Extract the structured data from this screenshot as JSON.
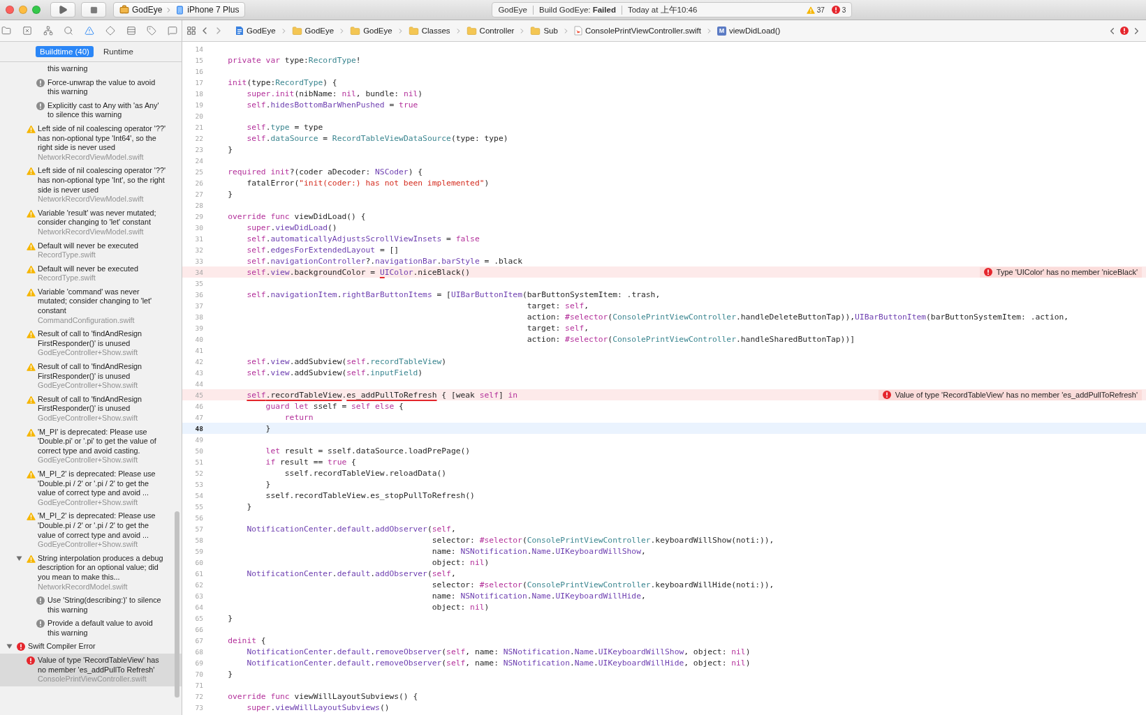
{
  "toolbar": {
    "scheme": "GodEye",
    "destination": "iPhone 7 Plus",
    "activity": {
      "project": "GodEye",
      "status": "Build GodEye: **Failed**",
      "time": "Today at 上午10:46",
      "warnings": "37",
      "errors": "3"
    }
  },
  "navigator_tabs": [
    {
      "selected": false
    },
    {
      "selected": false
    },
    {
      "selected": false
    },
    {
      "selected": false
    },
    {
      "selected": true
    },
    {
      "selected": false
    },
    {
      "selected": false
    },
    {
      "selected": false
    },
    {
      "selected": false
    }
  ],
  "jump_bar": {
    "crumbs": [
      {
        "kind": "project",
        "label": "GodEye"
      },
      {
        "kind": "folder",
        "label": "GodEye"
      },
      {
        "kind": "folder",
        "label": "GodEye"
      },
      {
        "kind": "folder",
        "label": "Classes"
      },
      {
        "kind": "folder",
        "label": "Controller"
      },
      {
        "kind": "folder",
        "label": "Sub"
      },
      {
        "kind": "file",
        "label": "ConsolePrintViewController.swift"
      },
      {
        "kind": "method",
        "badge": "M",
        "label": "viewDidLoad()"
      }
    ]
  },
  "issue_navigator": {
    "filters": [
      {
        "label": "Buildtime (40)",
        "selected": true
      },
      {
        "label": "Runtime",
        "selected": false
      }
    ],
    "items": [
      {
        "kind": "note",
        "clipped": true,
        "text": "this warning",
        "selected": false
      },
      {
        "kind": "note",
        "text": "Force-unwrap the value to avoid this warning",
        "selected": false
      },
      {
        "kind": "note",
        "text": "Explicitly cast to Any with 'as Any' to silence this warning",
        "selected": false
      },
      {
        "kind": "warning",
        "text": "Left side of nil coalescing operator '??' has non-optional type 'Int64', so the right side is never used",
        "file": "NetworkRecordViewModel.swift",
        "selected": false
      },
      {
        "kind": "warning",
        "text": "Left side of nil coalescing operator '??' has non-optional type 'Int', so the right side is never used",
        "file": "NetworkRecordViewModel.swift",
        "selected": false
      },
      {
        "kind": "warning",
        "text": "Variable 'result' was never mutated; consider changing to 'let' constant",
        "file": "NetworkRecordViewModel.swift",
        "selected": false
      },
      {
        "kind": "warning",
        "text": "Default will never be executed",
        "file": "RecordType.swift",
        "selected": false
      },
      {
        "kind": "warning",
        "text": "Default will never be executed",
        "file": "RecordType.swift",
        "selected": false
      },
      {
        "kind": "warning",
        "text": "Variable 'command' was never mutated; consider changing to 'let' constant",
        "file": "CommandConfiguration.swift",
        "selected": false
      },
      {
        "kind": "warning",
        "text": "Result of call to 'findAndResign FirstResponder()' is unused",
        "file": "GodEyeController+Show.swift",
        "selected": false
      },
      {
        "kind": "warning",
        "text": "Result of call to 'findAndResign FirstResponder()' is unused",
        "file": "GodEyeController+Show.swift",
        "selected": false
      },
      {
        "kind": "warning",
        "text": "Result of call to 'findAndResign FirstResponder()' is unused",
        "file": "GodEyeController+Show.swift",
        "selected": false
      },
      {
        "kind": "warning",
        "text": "'M_PI' is deprecated: Please use 'Double.pi' or '.pi' to get the value of correct type and avoid casting.",
        "file": "GodEyeController+Show.swift",
        "selected": false
      },
      {
        "kind": "warning",
        "text": "'M_PI_2' is deprecated: Please use 'Double.pi / 2' or '.pi / 2' to get the value of correct type and avoid ...",
        "file": "GodEyeController+Show.swift",
        "selected": false
      },
      {
        "kind": "warning",
        "text": "'M_PI_2' is deprecated: Please use 'Double.pi / 2' or '.pi / 2' to get the value of correct type and avoid ...",
        "file": "GodEyeController+Show.swift",
        "selected": false
      },
      {
        "kind": "warning",
        "text": "String interpolation produces a debug description for an optional value; did you mean to make this...",
        "file": "NetworkRecordModel.swift",
        "selected": false,
        "expanded": true,
        "children": [
          {
            "kind": "note",
            "text": "Use 'String(describing:)' to silence this warning",
            "selected": false
          },
          {
            "kind": "note",
            "text": "Provide a default value to avoid this warning",
            "selected": false
          }
        ]
      },
      {
        "kind": "category",
        "text": "Swift Compiler Error",
        "selected": false,
        "expanded": true,
        "children": [
          {
            "kind": "error",
            "text": "Value of type 'RecordTableView' has no member 'es_addPullTo Refresh'",
            "file": "ConsolePrintViewController.swift",
            "selected": true
          }
        ]
      }
    ]
  },
  "editor": {
    "lines": [
      {
        "number": "14",
        "current": false
      },
      {
        "number": "15",
        "current": false,
        "segments": [
          {
            "kind": "keyword",
            "text": "    private var "
          },
          {
            "kind": "plain",
            "text": "type:"
          },
          {
            "kind": "project",
            "text": "RecordType"
          },
          {
            "kind": "plain",
            "text": "!"
          }
        ]
      },
      {
        "number": "16",
        "current": false
      },
      {
        "number": "17",
        "current": false,
        "segments": [
          {
            "kind": "keyword",
            "text": "    init"
          },
          {
            "kind": "plain",
            "text": "(type:"
          },
          {
            "kind": "project",
            "text": "RecordType"
          },
          {
            "kind": "plain",
            "text": ") {"
          }
        ]
      },
      {
        "number": "18",
        "current": false,
        "segments": [
          {
            "kind": "keyword",
            "text": "        super.init"
          },
          {
            "kind": "plain",
            "text": "(nibName: "
          },
          {
            "kind": "keyword",
            "text": "nil"
          },
          {
            "kind": "plain",
            "text": ", bundle: "
          },
          {
            "kind": "keyword",
            "text": "nil"
          },
          {
            "kind": "plain",
            "text": ")"
          }
        ]
      },
      {
        "number": "19",
        "current": false,
        "segments": [
          {
            "kind": "keyword",
            "text": "        self"
          },
          {
            "kind": "plain",
            "text": "."
          },
          {
            "kind": "system",
            "text": "hidesBottomBarWhenPushed"
          },
          {
            "kind": "plain",
            "text": " = "
          },
          {
            "kind": "keyword",
            "text": "true"
          }
        ]
      },
      {
        "number": "20",
        "current": false
      },
      {
        "number": "21",
        "current": false,
        "segments": [
          {
            "kind": "keyword",
            "text": "        self"
          },
          {
            "kind": "plain",
            "text": "."
          },
          {
            "kind": "project",
            "text": "type"
          },
          {
            "kind": "plain",
            "text": " = type"
          }
        ]
      },
      {
        "number": "22",
        "current": false,
        "segments": [
          {
            "kind": "keyword",
            "text": "        self"
          },
          {
            "kind": "plain",
            "text": "."
          },
          {
            "kind": "project",
            "text": "dataSource"
          },
          {
            "kind": "plain",
            "text": " = "
          },
          {
            "kind": "project",
            "text": "RecordTableViewDataSource"
          },
          {
            "kind": "plain",
            "text": "(type: type)"
          }
        ]
      },
      {
        "number": "23",
        "current": false,
        "segments": [
          {
            "kind": "plain",
            "text": "    }"
          }
        ]
      },
      {
        "number": "24",
        "current": false
      },
      {
        "number": "25",
        "current": false,
        "segments": [
          {
            "kind": "keyword",
            "text": "    required init"
          },
          {
            "kind": "plain",
            "text": "?(coder aDecoder: "
          },
          {
            "kind": "system",
            "text": "NSCoder"
          },
          {
            "kind": "plain",
            "text": ") {"
          }
        ]
      },
      {
        "number": "26",
        "current": false,
        "segments": [
          {
            "kind": "plain",
            "text": "        fatalError("
          },
          {
            "kind": "string",
            "text": "\"init(coder:) has not been implemented\""
          },
          {
            "kind": "plain",
            "text": ")"
          }
        ]
      },
      {
        "number": "27",
        "current": false,
        "segments": [
          {
            "kind": "plain",
            "text": "    }"
          }
        ]
      },
      {
        "number": "28",
        "current": false
      },
      {
        "number": "29",
        "current": false,
        "segments": [
          {
            "kind": "keyword",
            "text": "    override func"
          },
          {
            "kind": "plain",
            "text": " viewDidLoad() {"
          }
        ]
      },
      {
        "number": "30",
        "current": false,
        "segments": [
          {
            "kind": "keyword",
            "text": "        super"
          },
          {
            "kind": "plain",
            "text": "."
          },
          {
            "kind": "system",
            "text": "viewDidLoad"
          },
          {
            "kind": "plain",
            "text": "()"
          }
        ]
      },
      {
        "number": "31",
        "current": false,
        "segments": [
          {
            "kind": "keyword",
            "text": "        self"
          },
          {
            "kind": "plain",
            "text": "."
          },
          {
            "kind": "system",
            "text": "automaticallyAdjustsScrollViewInsets"
          },
          {
            "kind": "plain",
            "text": " = "
          },
          {
            "kind": "keyword",
            "text": "false"
          }
        ]
      },
      {
        "number": "32",
        "current": false,
        "segments": [
          {
            "kind": "keyword",
            "text": "        self"
          },
          {
            "kind": "plain",
            "text": "."
          },
          {
            "kind": "system",
            "text": "edgesForExtendedLayout"
          },
          {
            "kind": "plain",
            "text": " = []"
          }
        ]
      },
      {
        "number": "33",
        "current": false,
        "segments": [
          {
            "kind": "keyword",
            "text": "        self"
          },
          {
            "kind": "plain",
            "text": "."
          },
          {
            "kind": "system",
            "text": "navigationController"
          },
          {
            "kind": "plain",
            "text": "?."
          },
          {
            "kind": "system",
            "text": "navigationBar"
          },
          {
            "kind": "plain",
            "text": "."
          },
          {
            "kind": "system",
            "text": "barStyle"
          },
          {
            "kind": "plain",
            "text": " = .black"
          }
        ]
      },
      {
        "number": "34",
        "current": false,
        "error": "Type 'UIColor' has no member 'niceBlack'",
        "segments": [
          {
            "kind": "keyword",
            "text": "        self"
          },
          {
            "kind": "plain",
            "text": "."
          },
          {
            "kind": "system",
            "text": "view"
          },
          {
            "kind": "plain",
            "text": ".backgroundColor = "
          },
          {
            "kind": "system",
            "text": "U",
            "error": true
          },
          {
            "kind": "system",
            "text": "IColor"
          },
          {
            "kind": "plain",
            "text": ".niceBlack()"
          }
        ]
      },
      {
        "number": "35",
        "current": false
      },
      {
        "number": "36",
        "current": false,
        "segments": [
          {
            "kind": "keyword",
            "text": "        self"
          },
          {
            "kind": "plain",
            "text": "."
          },
          {
            "kind": "system",
            "text": "navigationItem"
          },
          {
            "kind": "plain",
            "text": "."
          },
          {
            "kind": "system",
            "text": "rightBarButtonItems"
          },
          {
            "kind": "plain",
            "text": " = ["
          },
          {
            "kind": "system",
            "text": "UIBarButtonItem"
          },
          {
            "kind": "plain",
            "text": "(barButtonSystemItem: .trash,"
          }
        ]
      },
      {
        "number": "37",
        "current": false,
        "segments": [
          {
            "kind": "plain",
            "text": "                                                                   target: "
          },
          {
            "kind": "keyword",
            "text": "self"
          },
          {
            "kind": "plain",
            "text": ","
          }
        ]
      },
      {
        "number": "38",
        "current": false,
        "segments": [
          {
            "kind": "plain",
            "text": "                                                                   action: "
          },
          {
            "kind": "keyword",
            "text": "#selector"
          },
          {
            "kind": "plain",
            "text": "("
          },
          {
            "kind": "project",
            "text": "ConsolePrintViewController"
          },
          {
            "kind": "plain",
            "text": ".handleDeleteButtonTap)),"
          },
          {
            "kind": "system",
            "text": "UIBarButtonItem"
          },
          {
            "kind": "plain",
            "text": "(barButtonSystemItem: .action,"
          }
        ]
      },
      {
        "number": "39",
        "current": false,
        "segments": [
          {
            "kind": "plain",
            "text": "                                                                   target: "
          },
          {
            "kind": "keyword",
            "text": "self"
          },
          {
            "kind": "plain",
            "text": ","
          }
        ]
      },
      {
        "number": "40",
        "current": false,
        "segments": [
          {
            "kind": "plain",
            "text": "                                                                   action: "
          },
          {
            "kind": "keyword",
            "text": "#selector"
          },
          {
            "kind": "plain",
            "text": "("
          },
          {
            "kind": "project",
            "text": "ConsolePrintViewController"
          },
          {
            "kind": "plain",
            "text": ".handleSharedButtonTap))]"
          }
        ]
      },
      {
        "number": "41",
        "current": false
      },
      {
        "number": "42",
        "current": false,
        "segments": [
          {
            "kind": "keyword",
            "text": "        self"
          },
          {
            "kind": "plain",
            "text": "."
          },
          {
            "kind": "system",
            "text": "view"
          },
          {
            "kind": "plain",
            "text": ".addSubview("
          },
          {
            "kind": "keyword",
            "text": "self"
          },
          {
            "kind": "plain",
            "text": "."
          },
          {
            "kind": "project",
            "text": "recordTableView"
          },
          {
            "kind": "plain",
            "text": ")"
          }
        ]
      },
      {
        "number": "43",
        "current": false,
        "segments": [
          {
            "kind": "keyword",
            "text": "        self"
          },
          {
            "kind": "plain",
            "text": "."
          },
          {
            "kind": "system",
            "text": "view"
          },
          {
            "kind": "plain",
            "text": ".addSubview("
          },
          {
            "kind": "keyword",
            "text": "self"
          },
          {
            "kind": "plain",
            "text": "."
          },
          {
            "kind": "project",
            "text": "inputField"
          },
          {
            "kind": "plain",
            "text": ")"
          }
        ]
      },
      {
        "number": "44",
        "current": false
      },
      {
        "number": "45",
        "current": false,
        "error": "Value of type 'RecordTableView' has no member 'es_addPullToRefresh'",
        "segments": [
          {
            "kind": "keyword",
            "text": "        self",
            "error": true
          },
          {
            "kind": "plain",
            "text": ".recordTableView",
            "error": true
          },
          {
            "kind": "plain",
            "text": "."
          },
          {
            "kind": "plain",
            "text": "es_addPullToRefresh",
            "error": true
          },
          {
            "kind": "plain",
            "text": " { [weak "
          },
          {
            "kind": "keyword",
            "text": "self"
          },
          {
            "kind": "plain",
            "text": "] "
          },
          {
            "kind": "keyword",
            "text": "in"
          }
        ]
      },
      {
        "number": "46",
        "current": false,
        "segments": [
          {
            "kind": "keyword",
            "text": "            guard let"
          },
          {
            "kind": "plain",
            "text": " sself = "
          },
          {
            "kind": "keyword",
            "text": "self else"
          },
          {
            "kind": "plain",
            "text": " {"
          }
        ]
      },
      {
        "number": "47",
        "current": false,
        "segments": [
          {
            "kind": "keyword",
            "text": "                return"
          }
        ]
      },
      {
        "number": "48",
        "current": true,
        "segments": [
          {
            "kind": "plain",
            "text": "            }"
          }
        ]
      },
      {
        "number": "49",
        "current": false
      },
      {
        "number": "50",
        "current": false,
        "segments": [
          {
            "kind": "keyword",
            "text": "            let"
          },
          {
            "kind": "plain",
            "text": " result = sself.dataSource.loadPrePage()"
          }
        ]
      },
      {
        "number": "51",
        "current": false,
        "segments": [
          {
            "kind": "keyword",
            "text": "            if"
          },
          {
            "kind": "plain",
            "text": " result == "
          },
          {
            "kind": "keyword",
            "text": "true"
          },
          {
            "kind": "plain",
            "text": " {"
          }
        ]
      },
      {
        "number": "52",
        "current": false,
        "segments": [
          {
            "kind": "plain",
            "text": "                sself.recordTableView.reloadData()"
          }
        ]
      },
      {
        "number": "53",
        "current": false,
        "segments": [
          {
            "kind": "plain",
            "text": "            }"
          }
        ]
      },
      {
        "number": "54",
        "current": false,
        "segments": [
          {
            "kind": "plain",
            "text": "            sself.recordTableView.es_stopPullToRefresh()"
          }
        ]
      },
      {
        "number": "55",
        "current": false,
        "segments": [
          {
            "kind": "plain",
            "text": "        }"
          }
        ]
      },
      {
        "number": "56",
        "current": false
      },
      {
        "number": "57",
        "current": false,
        "segments": [
          {
            "kind": "system",
            "text": "        NotificationCenter"
          },
          {
            "kind": "plain",
            "text": "."
          },
          {
            "kind": "system",
            "text": "default"
          },
          {
            "kind": "plain",
            "text": "."
          },
          {
            "kind": "system",
            "text": "addObserver"
          },
          {
            "kind": "plain",
            "text": "("
          },
          {
            "kind": "keyword",
            "text": "self"
          },
          {
            "kind": "plain",
            "text": ","
          }
        ]
      },
      {
        "number": "58",
        "current": false,
        "segments": [
          {
            "kind": "plain",
            "text": "                                               selector: "
          },
          {
            "kind": "keyword",
            "text": "#selector"
          },
          {
            "kind": "plain",
            "text": "("
          },
          {
            "kind": "project",
            "text": "ConsolePrintViewController"
          },
          {
            "kind": "plain",
            "text": ".keyboardWillShow(noti:)),"
          }
        ]
      },
      {
        "number": "59",
        "current": false,
        "segments": [
          {
            "kind": "plain",
            "text": "                                               name: "
          },
          {
            "kind": "system",
            "text": "NSNotification"
          },
          {
            "kind": "plain",
            "text": "."
          },
          {
            "kind": "system",
            "text": "Name"
          },
          {
            "kind": "plain",
            "text": "."
          },
          {
            "kind": "system",
            "text": "UIKeyboardWillShow"
          },
          {
            "kind": "plain",
            "text": ","
          }
        ]
      },
      {
        "number": "60",
        "current": false,
        "segments": [
          {
            "kind": "plain",
            "text": "                                               object: "
          },
          {
            "kind": "keyword",
            "text": "nil"
          },
          {
            "kind": "plain",
            "text": ")"
          }
        ]
      },
      {
        "number": "61",
        "current": false,
        "segments": [
          {
            "kind": "system",
            "text": "        NotificationCenter"
          },
          {
            "kind": "plain",
            "text": "."
          },
          {
            "kind": "system",
            "text": "default"
          },
          {
            "kind": "plain",
            "text": "."
          },
          {
            "kind": "system",
            "text": "addObserver"
          },
          {
            "kind": "plain",
            "text": "("
          },
          {
            "kind": "keyword",
            "text": "self"
          },
          {
            "kind": "plain",
            "text": ","
          }
        ]
      },
      {
        "number": "62",
        "current": false,
        "segments": [
          {
            "kind": "plain",
            "text": "                                               selector: "
          },
          {
            "kind": "keyword",
            "text": "#selector"
          },
          {
            "kind": "plain",
            "text": "("
          },
          {
            "kind": "project",
            "text": "ConsolePrintViewController"
          },
          {
            "kind": "plain",
            "text": ".keyboardWillHide(noti:)),"
          }
        ]
      },
      {
        "number": "63",
        "current": false,
        "segments": [
          {
            "kind": "plain",
            "text": "                                               name: "
          },
          {
            "kind": "system",
            "text": "NSNotification"
          },
          {
            "kind": "plain",
            "text": "."
          },
          {
            "kind": "system",
            "text": "Name"
          },
          {
            "kind": "plain",
            "text": "."
          },
          {
            "kind": "system",
            "text": "UIKeyboardWillHide"
          },
          {
            "kind": "plain",
            "text": ","
          }
        ]
      },
      {
        "number": "64",
        "current": false,
        "segments": [
          {
            "kind": "plain",
            "text": "                                               object: "
          },
          {
            "kind": "keyword",
            "text": "nil"
          },
          {
            "kind": "plain",
            "text": ")"
          }
        ]
      },
      {
        "number": "65",
        "current": false,
        "segments": [
          {
            "kind": "plain",
            "text": "    }"
          }
        ]
      },
      {
        "number": "66",
        "current": false
      },
      {
        "number": "67",
        "current": false,
        "segments": [
          {
            "kind": "keyword",
            "text": "    deinit"
          },
          {
            "kind": "plain",
            "text": " {"
          }
        ]
      },
      {
        "number": "68",
        "current": false,
        "segments": [
          {
            "kind": "system",
            "text": "        NotificationCenter"
          },
          {
            "kind": "plain",
            "text": "."
          },
          {
            "kind": "system",
            "text": "default"
          },
          {
            "kind": "plain",
            "text": "."
          },
          {
            "kind": "system",
            "text": "removeObserver"
          },
          {
            "kind": "plain",
            "text": "("
          },
          {
            "kind": "keyword",
            "text": "self"
          },
          {
            "kind": "plain",
            "text": ", name: "
          },
          {
            "kind": "system",
            "text": "NSNotification"
          },
          {
            "kind": "plain",
            "text": "."
          },
          {
            "kind": "system",
            "text": "Name"
          },
          {
            "kind": "plain",
            "text": "."
          },
          {
            "kind": "system",
            "text": "UIKeyboardWillShow"
          },
          {
            "kind": "plain",
            "text": ", object: "
          },
          {
            "kind": "keyword",
            "text": "nil"
          },
          {
            "kind": "plain",
            "text": ")"
          }
        ]
      },
      {
        "number": "69",
        "current": false,
        "segments": [
          {
            "kind": "system",
            "text": "        NotificationCenter"
          },
          {
            "kind": "plain",
            "text": "."
          },
          {
            "kind": "system",
            "text": "default"
          },
          {
            "kind": "plain",
            "text": "."
          },
          {
            "kind": "system",
            "text": "removeObserver"
          },
          {
            "kind": "plain",
            "text": "("
          },
          {
            "kind": "keyword",
            "text": "self"
          },
          {
            "kind": "plain",
            "text": ", name: "
          },
          {
            "kind": "system",
            "text": "NSNotification"
          },
          {
            "kind": "plain",
            "text": "."
          },
          {
            "kind": "system",
            "text": "Name"
          },
          {
            "kind": "plain",
            "text": "."
          },
          {
            "kind": "system",
            "text": "UIKeyboardWillHide"
          },
          {
            "kind": "plain",
            "text": ", object: "
          },
          {
            "kind": "keyword",
            "text": "nil"
          },
          {
            "kind": "plain",
            "text": ")"
          }
        ]
      },
      {
        "number": "70",
        "current": false,
        "segments": [
          {
            "kind": "plain",
            "text": "    }"
          }
        ]
      },
      {
        "number": "71",
        "current": false
      },
      {
        "number": "72",
        "current": false,
        "segments": [
          {
            "kind": "keyword",
            "text": "    override func"
          },
          {
            "kind": "plain",
            "text": " viewWillLayoutSubviews() {"
          }
        ]
      },
      {
        "number": "73",
        "current": false,
        "segments": [
          {
            "kind": "keyword",
            "text": "        super"
          },
          {
            "kind": "plain",
            "text": "."
          },
          {
            "kind": "system",
            "text": "viewWillLayoutSubviews"
          },
          {
            "kind": "plain",
            "text": "()"
          }
        ]
      }
    ]
  }
}
